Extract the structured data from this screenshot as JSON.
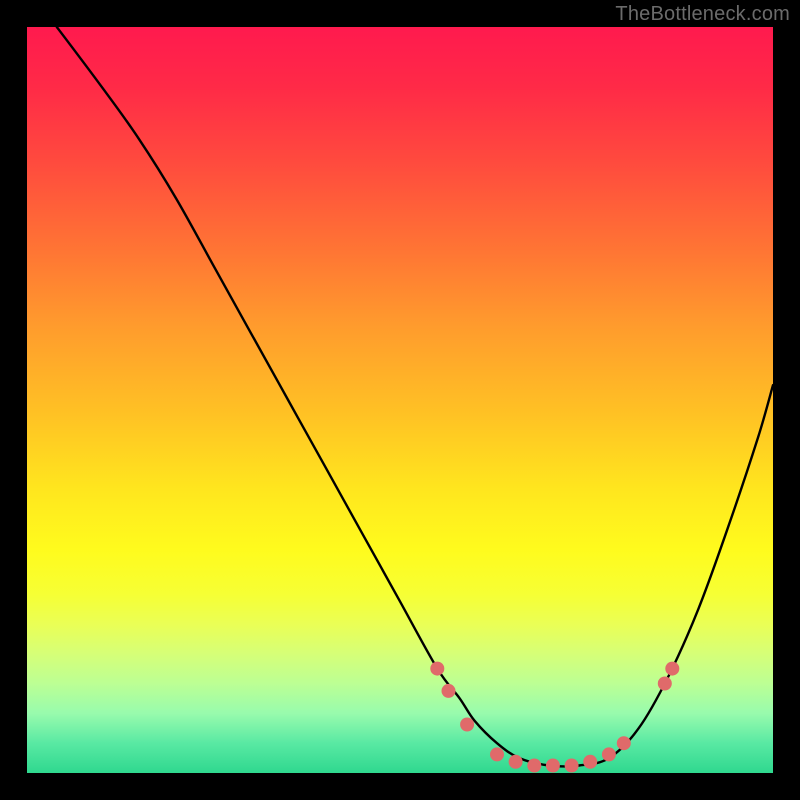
{
  "watermark": "TheBottleneck.com",
  "chart_data": {
    "type": "line",
    "title": "",
    "xlabel": "",
    "ylabel": "",
    "xlim": [
      0,
      100
    ],
    "ylim": [
      0,
      100
    ],
    "grid": false,
    "legend": false,
    "series": [
      {
        "name": "curve",
        "color": "#000000",
        "x": [
          4,
          10,
          15,
          20,
          25,
          30,
          35,
          40,
          45,
          50,
          55,
          58,
          60,
          63,
          66,
          70,
          74,
          78,
          82,
          86,
          90,
          94,
          98,
          100
        ],
        "y": [
          100,
          92,
          85,
          77,
          68,
          59,
          50,
          41,
          32,
          23,
          14,
          10,
          7,
          4,
          2,
          1,
          1,
          2,
          6,
          13,
          22,
          33,
          45,
          52
        ]
      }
    ],
    "markers": {
      "name": "dots",
      "color": "#e06a6a",
      "radius": 7,
      "points": [
        {
          "x": 55,
          "y": 14
        },
        {
          "x": 56.5,
          "y": 11
        },
        {
          "x": 59,
          "y": 6.5
        },
        {
          "x": 63,
          "y": 2.5
        },
        {
          "x": 65.5,
          "y": 1.5
        },
        {
          "x": 68,
          "y": 1
        },
        {
          "x": 70.5,
          "y": 1
        },
        {
          "x": 73,
          "y": 1
        },
        {
          "x": 75.5,
          "y": 1.5
        },
        {
          "x": 78,
          "y": 2.5
        },
        {
          "x": 80,
          "y": 4
        },
        {
          "x": 85.5,
          "y": 12
        },
        {
          "x": 86.5,
          "y": 14
        }
      ]
    }
  }
}
